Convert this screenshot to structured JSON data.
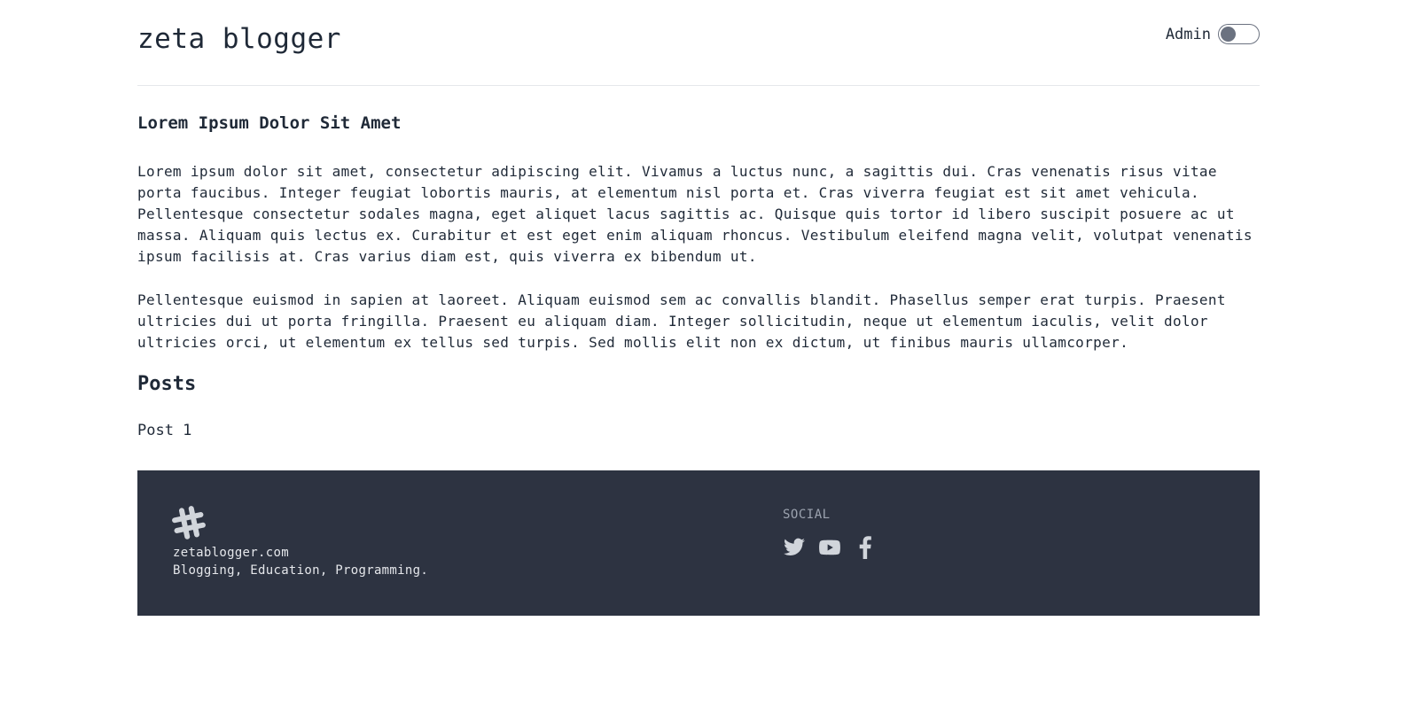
{
  "header": {
    "site_title": "zeta blogger",
    "admin_label": "Admin",
    "admin_toggle_on": false
  },
  "article": {
    "title": "Lorem Ipsum Dolor Sit Amet",
    "paragraphs": [
      "Lorem ipsum dolor sit amet, consectetur adipiscing elit. Vivamus a luctus nunc, a sagittis dui. Cras venenatis risus vitae porta faucibus. Integer feugiat lobortis mauris, at elementum nisl porta et. Cras viverra feugiat est sit amet vehicula. Pellentesque consectetur sodales magna, eget aliquet lacus sagittis ac. Quisque quis tortor id libero suscipit posuere ac ut massa. Aliquam quis lectus ex. Curabitur et est eget enim aliquam rhoncus. Vestibulum eleifend magna velit, volutpat venenatis ipsum facilisis at. Cras varius diam est, quis viverra ex bibendum ut.",
      "Pellentesque euismod in sapien at laoreet. Aliquam euismod sem ac convallis blandit. Phasellus semper erat turpis. Praesent ultricies dui ut porta fringilla. Praesent eu aliquam diam. Integer sollicitudin, neque ut elementum iaculis, velit dolor ultricies orci, ut elementum ex tellus sed turpis. Sed mollis elit non ex dictum, ut finibus mauris ullamcorper."
    ]
  },
  "posts": {
    "heading": "Posts",
    "items": [
      "Post 1"
    ]
  },
  "footer": {
    "logo_icon": "hashtag-icon",
    "domain": "zetablogger.com",
    "tagline": "Blogging, Education, Programming.",
    "social_heading": "SOCIAL",
    "social_icons": [
      "twitter-icon",
      "youtube-icon",
      "facebook-icon"
    ]
  },
  "colors": {
    "text": "#1f2937",
    "footer_bg": "#2d3341",
    "footer_text": "#e5e7eb",
    "footer_muted": "#9ca3af",
    "toggle": "#6b7280"
  }
}
